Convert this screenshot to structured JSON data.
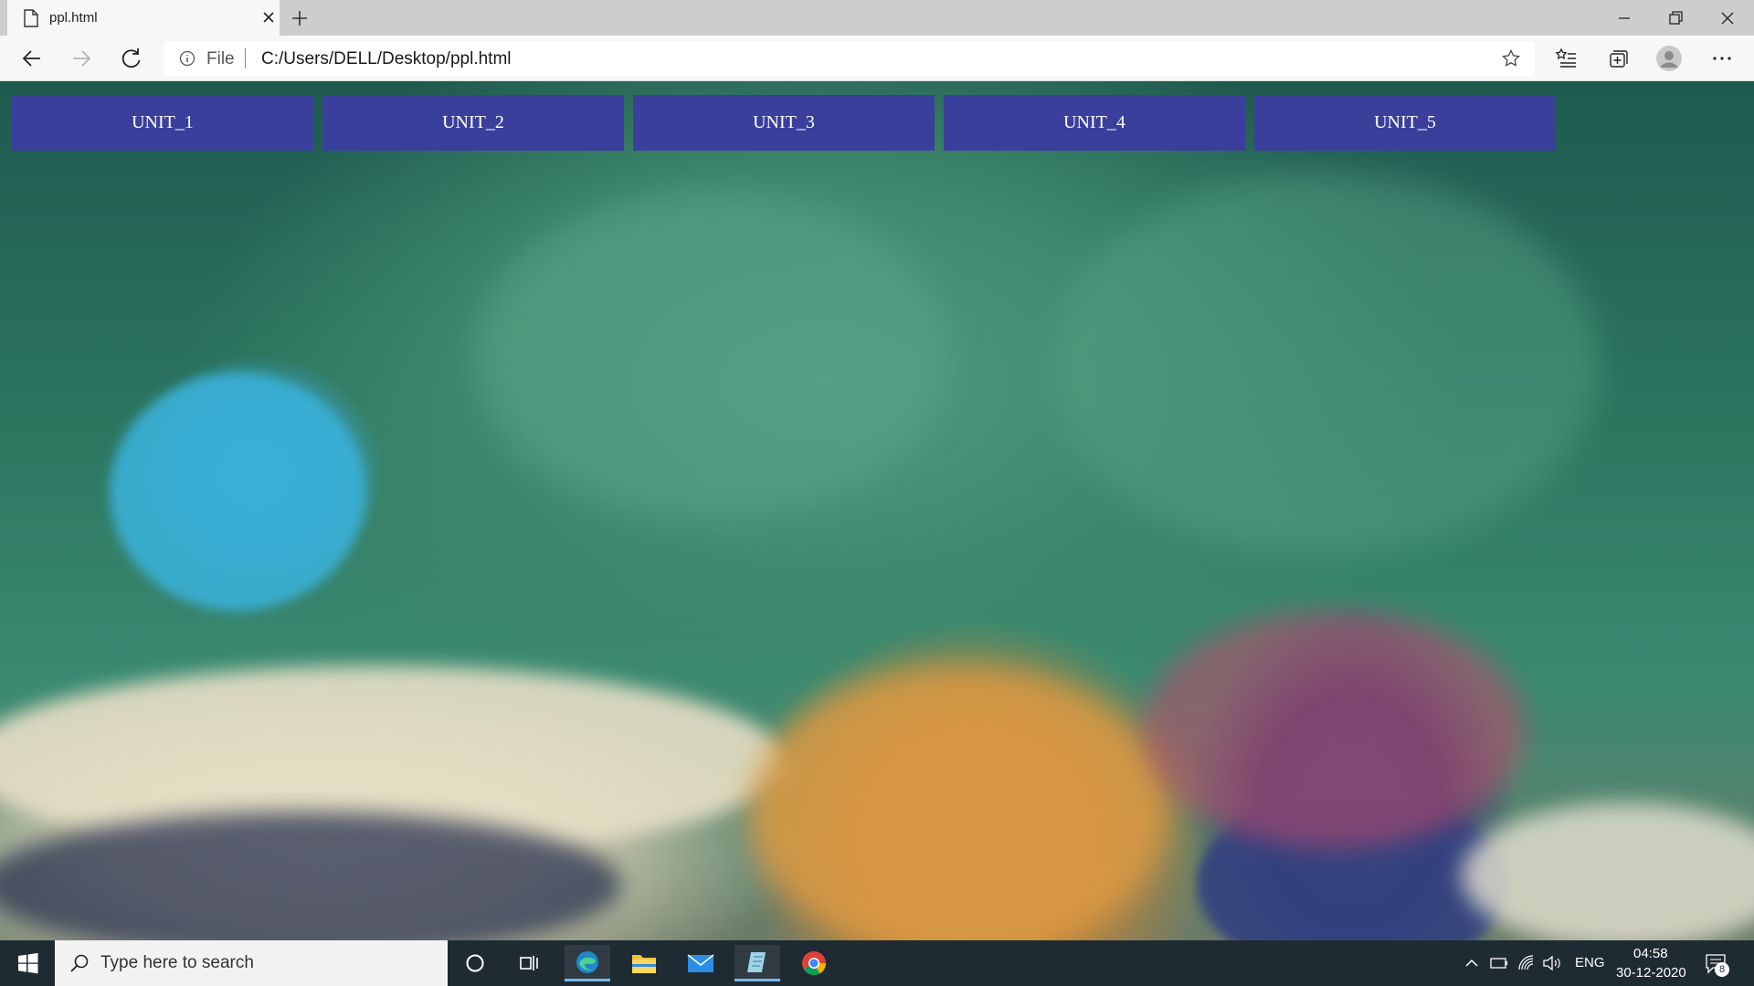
{
  "browser": {
    "tab_title": "ppl.html",
    "address_scheme": "File",
    "address_url": "C:/Users/DELL/Desktop/ppl.html"
  },
  "units": [
    "UNIT_1",
    "UNIT_2",
    "UNIT_3",
    "UNIT_4",
    "UNIT_5"
  ],
  "colors": {
    "unit_button_bg": "#3b3f9c",
    "unit_button_text": "#ffffff",
    "taskbar_bg": "#1f2b33"
  },
  "taskbar": {
    "search_placeholder": "Type here to search",
    "language": "ENG",
    "time": "04:58",
    "date": "30-12-2020",
    "notification_count": "8"
  }
}
